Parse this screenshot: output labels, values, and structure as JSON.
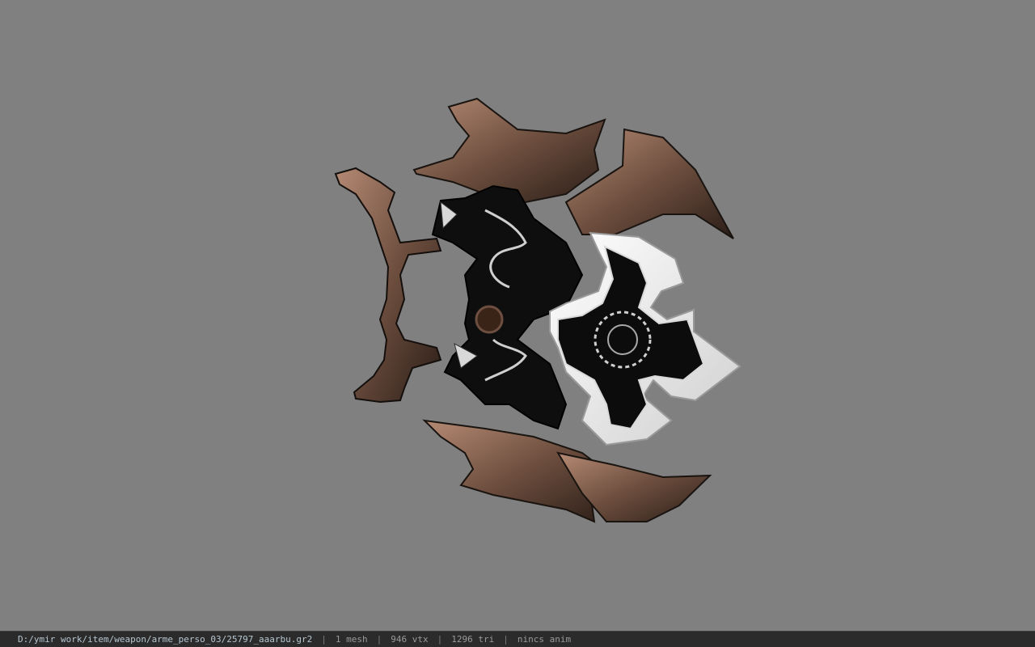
{
  "viewer": {
    "model_icon": "ornate-dark-weapon-model",
    "background_color": "#808080"
  },
  "status_bar": {
    "file_path": "D:/ymir work/item/weapon/arme_perso_03/25797_aaarbu.gr2",
    "separator": "|",
    "mesh_count": "1 mesh",
    "vertex_count": "946 vtx",
    "triangle_count": "1296 tri",
    "animation": "nincs anim"
  },
  "colors": {
    "status_bg": "#2b2b2b",
    "status_text": "#9a9a9a",
    "path_text": "#b7c6d0",
    "model_dark": "#0d0d0d",
    "model_bronze": "#7a5a48",
    "model_silver": "#e8e8e8"
  }
}
